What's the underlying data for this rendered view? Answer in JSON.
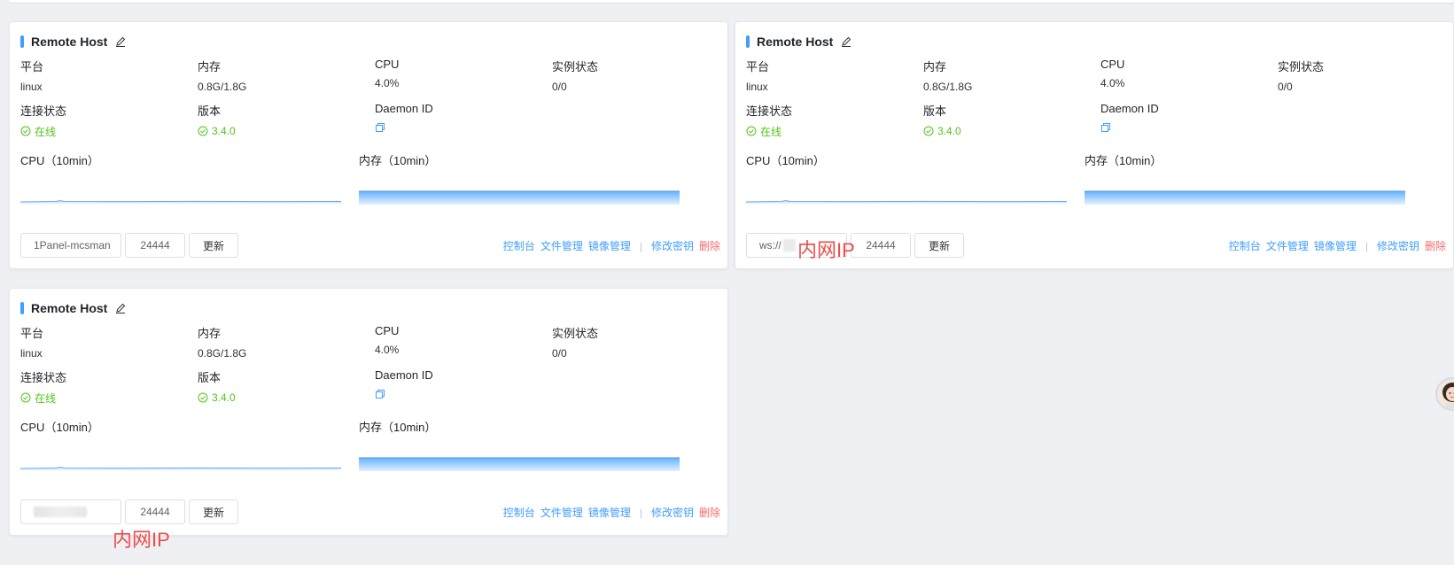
{
  "annotations": {
    "intranet_ip": "内网IP"
  },
  "cards": [
    {
      "title": "Remote Host",
      "platform_label": "平台",
      "platform": "linux",
      "memory_label": "内存",
      "memory": "0.8G/1.8G",
      "cpu_label": "CPU",
      "cpu": "4.0%",
      "instances_label": "实例状态",
      "instances": "0/0",
      "conn_label": "连接状态",
      "conn": "在线",
      "version_label": "版本",
      "version": "3.4.0",
      "daemon_label": "Daemon ID",
      "cpu_chart_label": "CPU（10min）",
      "mem_chart_label": "内存（10min）",
      "address": "1Panel-mcsman",
      "port": "24444",
      "update_btn": "更新",
      "actions": [
        "控制台",
        "文件管理",
        "镜像管理"
      ],
      "change_key": "修改密钥",
      "delete": "删除"
    },
    {
      "title": "Remote Host",
      "platform_label": "平台",
      "platform": "linux",
      "memory_label": "内存",
      "memory": "0.8G/1.8G",
      "cpu_label": "CPU",
      "cpu": "4.0%",
      "instances_label": "实例状态",
      "instances": "0/0",
      "conn_label": "连接状态",
      "conn": "在线",
      "version_label": "版本",
      "version": "3.4.0",
      "daemon_label": "Daemon ID",
      "cpu_chart_label": "CPU（10min）",
      "mem_chart_label": "内存（10min）",
      "address": "ws://",
      "port": "24444",
      "update_btn": "更新",
      "actions": [
        "控制台",
        "文件管理",
        "镜像管理"
      ],
      "change_key": "修改密钥",
      "delete": "删除"
    },
    {
      "title": "Remote Host",
      "platform_label": "平台",
      "platform": "linux",
      "memory_label": "内存",
      "memory": "0.8G/1.8G",
      "cpu_label": "CPU",
      "cpu": "4.0%",
      "instances_label": "实例状态",
      "instances": "0/0",
      "conn_label": "连接状态",
      "conn": "在线",
      "version_label": "版本",
      "version": "3.4.0",
      "daemon_label": "Daemon ID",
      "cpu_chart_label": "CPU（10min）",
      "mem_chart_label": "内存（10min）",
      "address": "",
      "port": "24444",
      "update_btn": "更新",
      "actions": [
        "控制台",
        "文件管理",
        "镜像管理"
      ],
      "change_key": "修改密钥",
      "delete": "删除"
    }
  ],
  "colors": {
    "accent": "#409eff",
    "online": "#52c41a",
    "danger": "#f56c6c",
    "annotation": "#f04b4b"
  }
}
